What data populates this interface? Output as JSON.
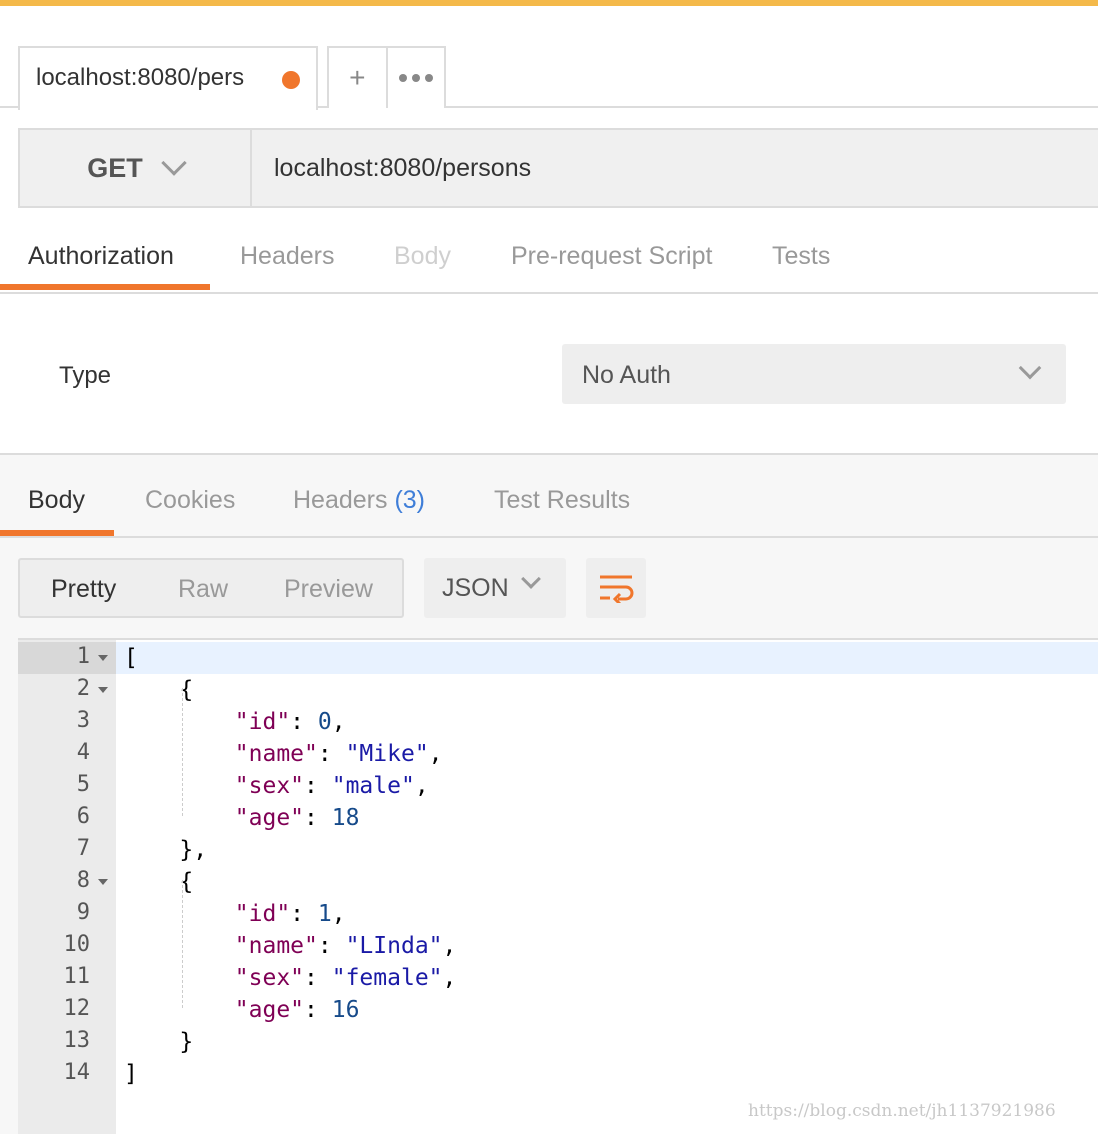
{
  "tab": {
    "label": "localhost:8080/pers",
    "new_tab": "+",
    "more": "more-options"
  },
  "request": {
    "method": "GET",
    "url": "localhost:8080/persons"
  },
  "request_tabs": [
    "Authorization",
    "Headers",
    "Body",
    "Pre-request Script",
    "Tests"
  ],
  "auth": {
    "type_label": "Type",
    "selected": "No Auth"
  },
  "response_tabs": {
    "body": "Body",
    "cookies": "Cookies",
    "headers": "Headers",
    "headers_count": "(3)",
    "tests": "Test Results"
  },
  "format": {
    "pretty": "Pretty",
    "raw": "Raw",
    "preview": "Preview",
    "language": "JSON"
  },
  "colors": {
    "accent": "#f0762c",
    "top_strip": "#f4b94a",
    "json_key": "#7f0055",
    "json_string": "#1a1aa6",
    "json_number": "#164a8a"
  },
  "icons": {
    "wrap": "wrap-lines-icon",
    "dropdown": "chevron-down-icon"
  },
  "code_lines": [
    {
      "ln": "1",
      "text": "["
    },
    {
      "ln": "2",
      "text": "    {"
    },
    {
      "ln": "3",
      "text": "        \"id\": 0,"
    },
    {
      "ln": "4",
      "text": "        \"name\": \"Mike\","
    },
    {
      "ln": "5",
      "text": "        \"sex\": \"male\","
    },
    {
      "ln": "6",
      "text": "        \"age\": 18"
    },
    {
      "ln": "7",
      "text": "    },"
    },
    {
      "ln": "8",
      "text": "    {"
    },
    {
      "ln": "9",
      "text": "        \"id\": 1,"
    },
    {
      "ln": "10",
      "text": "        \"name\": \"LInda\","
    },
    {
      "ln": "11",
      "text": "        \"sex\": \"female\","
    },
    {
      "ln": "12",
      "text": "        \"age\": 16"
    },
    {
      "ln": "13",
      "text": "    }"
    },
    {
      "ln": "14",
      "text": "]"
    }
  ],
  "watermark": "https://blog.csdn.net/jh1137921986"
}
